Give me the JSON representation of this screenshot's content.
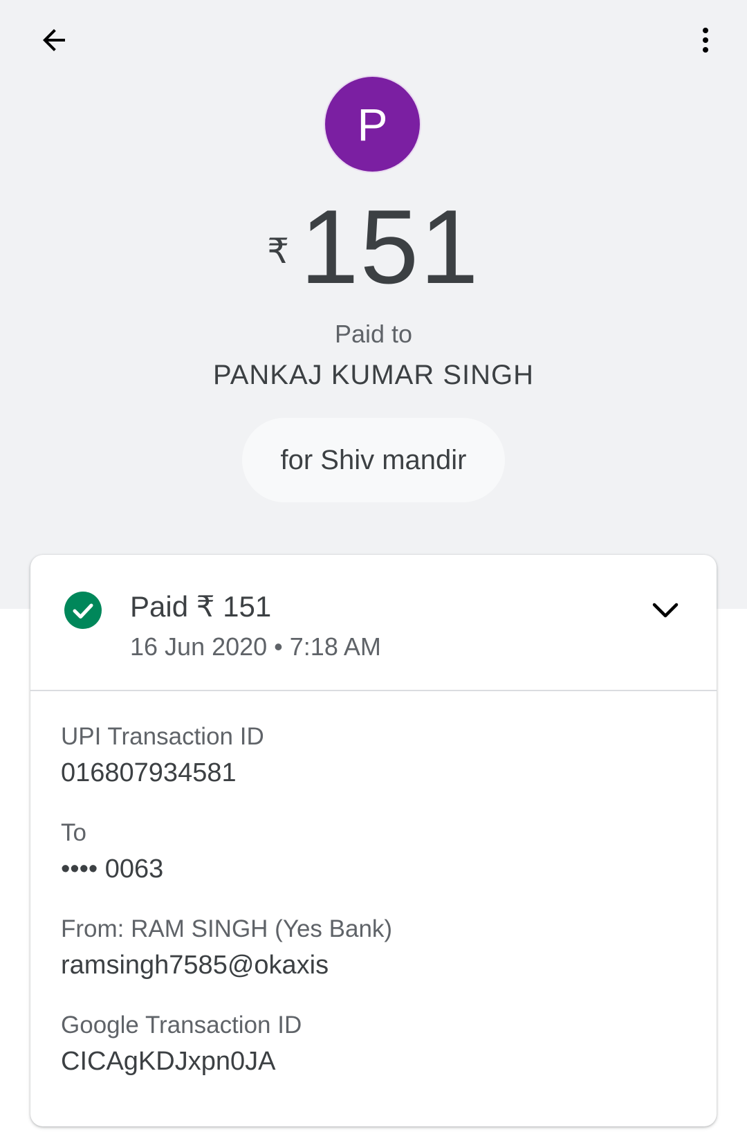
{
  "header": {
    "back_icon": "arrow-back-icon",
    "menu_icon": "more-vert-icon"
  },
  "payee": {
    "avatar_letter": "P",
    "avatar_color": "#7b1fa2",
    "paid_to_label": "Paid to",
    "name": "PANKAJ KUMAR SINGH",
    "note": "for Shiv mandir"
  },
  "amount": {
    "currency": "₹",
    "value": "151"
  },
  "status": {
    "icon": "check-circle-icon",
    "color": "#00875a",
    "title": "Paid ₹ 151",
    "datetime": "16 Jun 2020 • 7:18 AM",
    "expand_icon": "chevron-down-icon"
  },
  "details": [
    {
      "label": "UPI Transaction ID",
      "value": "016807934581"
    },
    {
      "label": "To",
      "value": "•••• 0063"
    },
    {
      "label": "From: RAM SINGH (Yes Bank)",
      "value": "ramsingh7585@okaxis"
    },
    {
      "label": "Google Transaction ID",
      "value": "CICAgKDJxpn0JA"
    }
  ]
}
